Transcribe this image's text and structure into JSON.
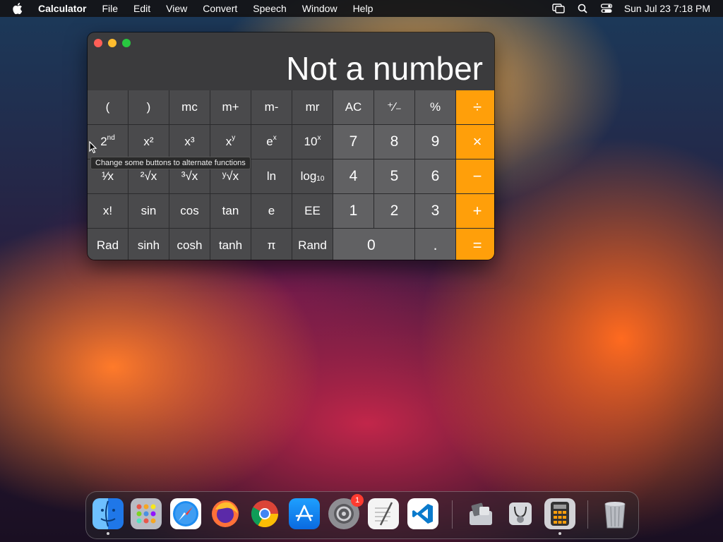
{
  "menubar": {
    "app_name": "Calculator",
    "items": [
      "File",
      "Edit",
      "View",
      "Convert",
      "Speech",
      "Window",
      "Help"
    ],
    "clock": "Sun Jul 23  7:18 PM"
  },
  "calculator": {
    "display": "Not a number",
    "tooltip": "Change some buttons to alternate functions",
    "keys": {
      "open_paren": "(",
      "close_paren": ")",
      "mc": "mc",
      "m_plus": "m+",
      "m_minus": "m-",
      "mr": "mr",
      "ac": "AC",
      "plus_minus": "⁺∕₋",
      "percent": "%",
      "divide": "÷",
      "second": "2",
      "second_sup": "nd",
      "x_squared": "x²",
      "x_cubed": "x³",
      "x_pow_y": "x",
      "x_pow_y_sup": "y",
      "e_pow_x": "e",
      "e_pow_x_sup": "x",
      "ten_pow_x": "10",
      "ten_pow_x_sup": "x",
      "seven": "7",
      "eight": "8",
      "nine": "9",
      "multiply": "×",
      "reciprocal": "¹⁄x",
      "sqrt": "²√x",
      "cbrt": "³√x",
      "yroot": "ʸ√x",
      "ln": "ln",
      "log10": "log",
      "log10_sub": "10",
      "four": "4",
      "five": "5",
      "six": "6",
      "minus": "−",
      "factorial": "x!",
      "sin": "sin",
      "cos": "cos",
      "tan": "tan",
      "e": "e",
      "ee": "EE",
      "one": "1",
      "two": "2",
      "three": "3",
      "plus": "+",
      "rad": "Rad",
      "sinh": "sinh",
      "cosh": "cosh",
      "tanh": "tanh",
      "pi": "π",
      "rand": "Rand",
      "zero": "0",
      "decimal": ".",
      "equals": "="
    }
  },
  "dock": {
    "items": [
      "finder-icon",
      "launchpad-icon",
      "safari-icon",
      "firefox-icon",
      "chrome-icon",
      "app-store-icon",
      "system-settings-icon",
      "textedit-icon",
      "vscode-icon",
      "migration-assistant-icon",
      "disk-utility-icon",
      "calculator-icon",
      "trash-icon"
    ],
    "settings_badge": "1",
    "colors": {
      "accent": "#ff9f0a"
    }
  }
}
